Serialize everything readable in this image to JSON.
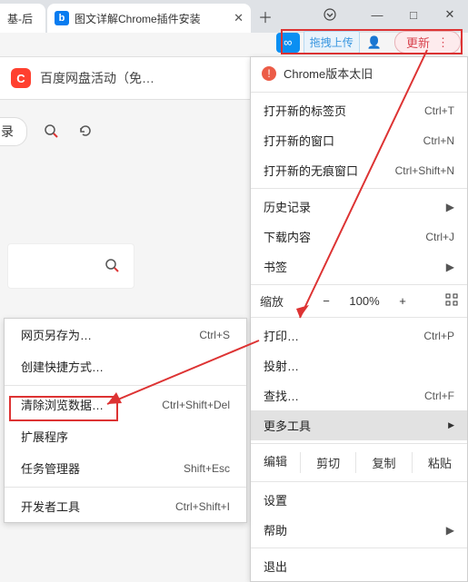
{
  "tabs": {
    "t1_title": "基-后",
    "t2_title": "图文详解Chrome插件安装",
    "t2_icon": "b"
  },
  "cloud": {
    "upload": "拖拽上传",
    "update": "更新"
  },
  "brand": {
    "label": "百度网盘活动（免…",
    "icon": "C"
  },
  "nav": {
    "label": "录"
  },
  "menu": {
    "version_old": "Chrome版本太旧",
    "new_tab": "打开新的标签页",
    "sc_new_tab": "Ctrl+T",
    "new_win": "打开新的窗口",
    "sc_new_win": "Ctrl+N",
    "incog": "打开新的无痕窗口",
    "sc_incog": "Ctrl+Shift+N",
    "history": "历史记录",
    "downloads": "下载内容",
    "sc_downloads": "Ctrl+J",
    "bookmarks": "书签",
    "zoom_label": "缩放",
    "zoom_value": "100%",
    "print": "打印…",
    "sc_print": "Ctrl+P",
    "cast": "投射…",
    "find": "查找…",
    "sc_find": "Ctrl+F",
    "more_tools": "更多工具",
    "edit": "编辑",
    "cut": "剪切",
    "copy": "复制",
    "paste": "粘贴",
    "settings": "设置",
    "help": "帮助",
    "exit": "退出"
  },
  "sub": {
    "save_as": "网页另存为…",
    "sc_save_as": "Ctrl+S",
    "shortcut": "创建快捷方式…",
    "clear": "清除浏览数据…",
    "sc_clear": "Ctrl+Shift+Del",
    "extensions": "扩展程序",
    "task_mgr": "任务管理器",
    "sc_task": "Shift+Esc",
    "devtools": "开发者工具",
    "sc_dev": "Ctrl+Shift+I"
  }
}
